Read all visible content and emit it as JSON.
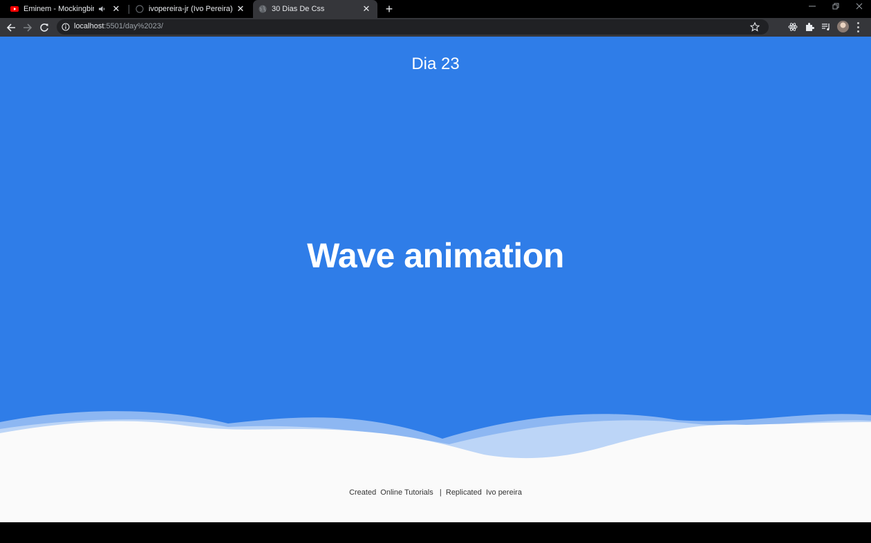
{
  "browser": {
    "tabs": [
      {
        "title": "Eminem - Mockingbird (Offic",
        "favicon": "youtube-icon",
        "audio": "speaker-icon"
      },
      {
        "title": "ivopereira-jr (Ivo Pereira)",
        "favicon": "github-icon"
      },
      {
        "title": "30 Dias De Css",
        "favicon": "globe-icon",
        "active": true
      }
    ],
    "new_tab_label": "+",
    "close_glyph": "✕",
    "address": {
      "host": "localhost",
      "path": ":5501/day%2023/"
    },
    "extensions": [
      "react-devtools-icon",
      "puzzle-icon",
      "media-queue-icon"
    ]
  },
  "page": {
    "day_title": "Dia 23",
    "hero_title": "Wave animation",
    "credits": "Created  Online Tutorials   |  Replicated  Ivo pereira",
    "colors": {
      "background": "#2f7de8",
      "footer": "#fafafa",
      "wave_light": "#8db7f2",
      "wave_mid": "#bcd5f7"
    }
  }
}
